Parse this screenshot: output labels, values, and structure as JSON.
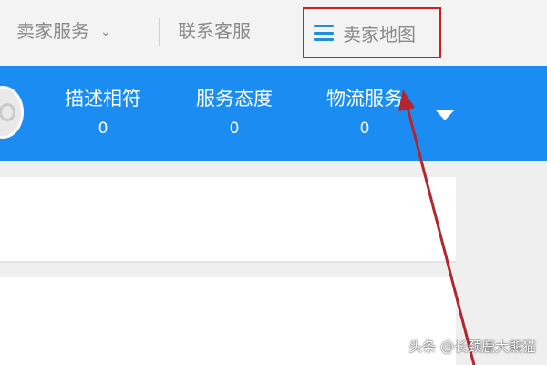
{
  "top_nav": {
    "seller_service": "卖家服务",
    "contact_service": "联系客服",
    "seller_map": "卖家地图"
  },
  "rating_bar": {
    "items": [
      {
        "label": "描述相符",
        "value": "0"
      },
      {
        "label": "服务态度",
        "value": "0"
      },
      {
        "label": "物流服务",
        "value": "0"
      }
    ]
  },
  "colors": {
    "accent_blue": "#1b8df2",
    "highlight_red": "#d11d1d",
    "arrow_red": "#b3262e"
  },
  "icons": {
    "seller_map": "menu-icon",
    "seller_service": "chevron-down-icon",
    "rating_toggle": "triangle-down-icon"
  },
  "watermark": "头条 @长颈鹿大熊猫"
}
